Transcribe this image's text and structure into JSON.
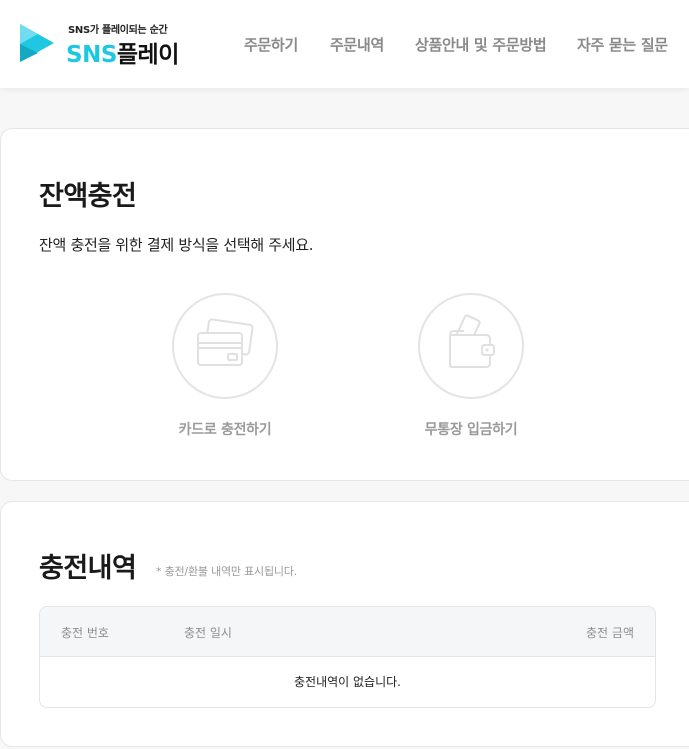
{
  "header": {
    "logo": {
      "tagline": "SNS가 플레이되는 순간",
      "name_part1": "SNS",
      "name_part2": "플레이"
    },
    "nav": [
      {
        "label": "주문하기"
      },
      {
        "label": "주문내역"
      },
      {
        "label": "상품안내 및 주문방법"
      },
      {
        "label": "자주 묻는 질문"
      }
    ]
  },
  "charge": {
    "title": "잔액충전",
    "subtitle": "잔액 충전을 위한 결제 방식을 선택해 주세요.",
    "methods": [
      {
        "label": "카드로 충전하기",
        "icon": "credit-card-icon"
      },
      {
        "label": "무통장 입금하기",
        "icon": "wallet-icon"
      }
    ]
  },
  "history": {
    "title": "충전내역",
    "note": "* 충전/환불 내역만 표시됩니다.",
    "columns": [
      "충전 번호",
      "충전 일시",
      "충전 금액"
    ],
    "rows": [],
    "empty_message": "충전내역이 없습니다."
  },
  "colors": {
    "brand": "#1ec8e0",
    "nav_text": "#8a8a8a",
    "muted": "#9a9a9a"
  }
}
